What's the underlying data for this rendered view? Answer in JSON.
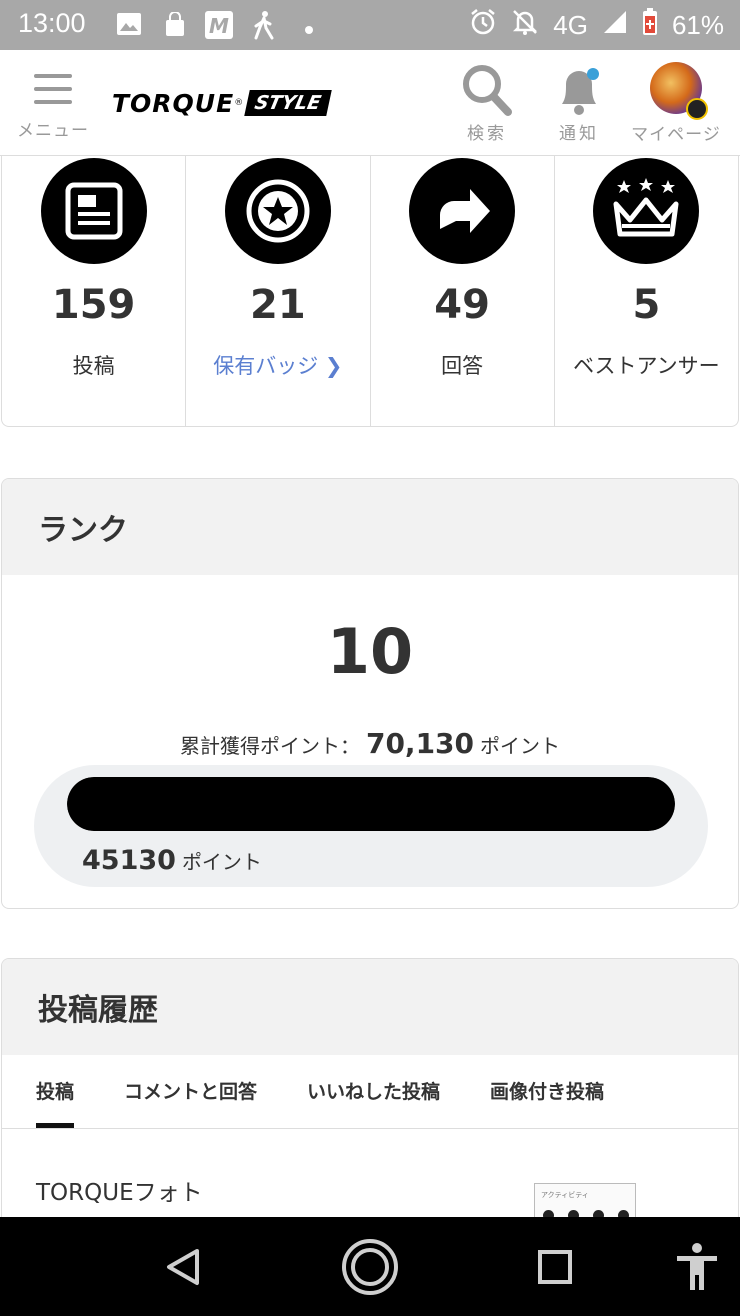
{
  "status_bar": {
    "time": "13:00",
    "icons_left": [
      "image-icon",
      "shopping-icon",
      "m-app-icon",
      "walking-icon",
      "dot-icon"
    ],
    "icons_right": [
      "alarm-icon",
      "mute-icon"
    ],
    "network": "4G",
    "battery": "61%"
  },
  "header": {
    "menu_label": "メニュー",
    "logo_main": "TORQUE",
    "logo_mark": "®",
    "logo_sub": "STYLE",
    "search_label": "検索",
    "notify_label": "通知",
    "mypage_label": "マイページ",
    "accent_color": "#3aa0d8"
  },
  "stats": [
    {
      "icon": "article-icon",
      "value": "159",
      "label": "投稿"
    },
    {
      "icon": "badge-star-icon",
      "value": "21",
      "label": "保有バッジ",
      "link_arrow": "❯"
    },
    {
      "icon": "reply-arrow-icon",
      "value": "49",
      "label": "回答"
    },
    {
      "icon": "crown-icon",
      "value": "5",
      "label": "ベストアンサー"
    }
  ],
  "rank": {
    "title": "ランク",
    "level": "10",
    "total_label": "累計獲得ポイント：",
    "total_value": "70,130",
    "total_unit": "ポイント",
    "progress_fraction": 1.0,
    "current_points": "45130",
    "current_unit": "ポイント"
  },
  "history": {
    "title": "投稿履歴",
    "tabs": [
      "投稿",
      "コメントと回答",
      "いいねした投稿",
      "画像付き投稿"
    ],
    "active_tab": 0,
    "first_post_title": "TORQUEフォト",
    "thumb_caption": "アクティビティ"
  },
  "nav": [
    "back-icon",
    "home-icon",
    "recents-icon",
    "accessibility-icon"
  ]
}
